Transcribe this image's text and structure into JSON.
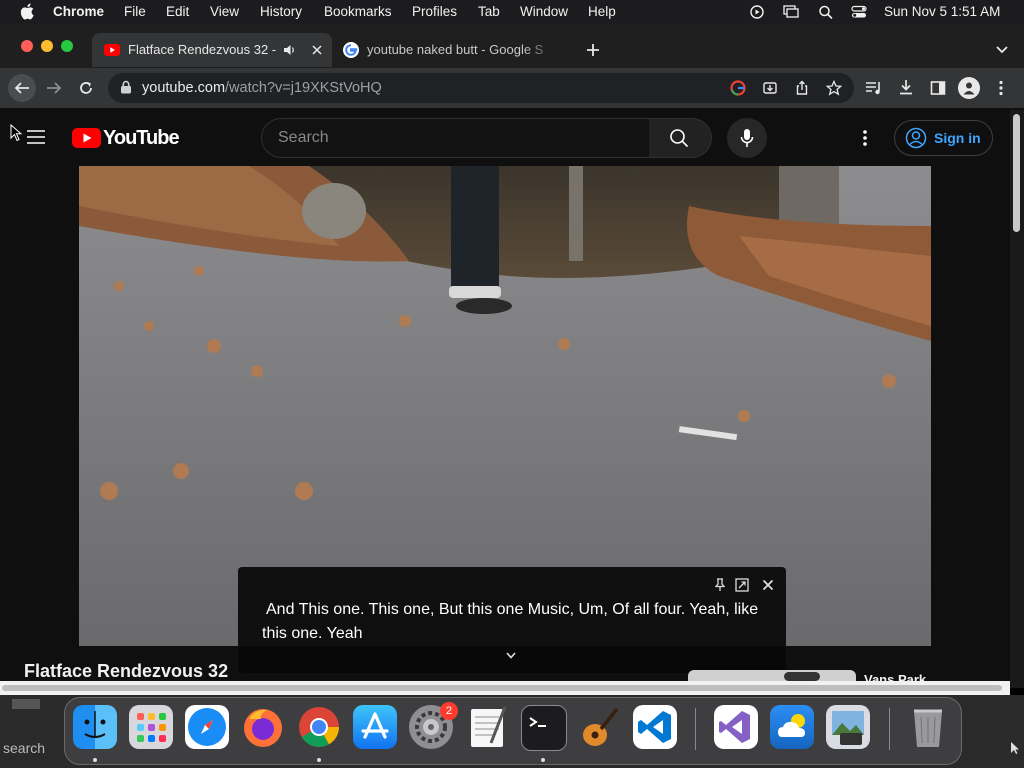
{
  "menubar": {
    "app": "Chrome",
    "items": [
      "File",
      "Edit",
      "View",
      "History",
      "Bookmarks",
      "Profiles",
      "Tab",
      "Window",
      "Help"
    ],
    "clock": "Sun Nov 5  1:51 AM"
  },
  "tabs": [
    {
      "title": "Flatface Rendezvous 32 -",
      "favicon": "youtube-icon",
      "audio": true
    },
    {
      "title": "youtube naked butt - Google S",
      "favicon": "google-icon"
    }
  ],
  "toolbar": {
    "url_host": "youtube.com",
    "url_path": "/watch?v=j19XKStVoHQ"
  },
  "youtube": {
    "logo_text": "YouTube",
    "search_placeholder": "Search",
    "sign_in": "Sign in",
    "video_title": "Flatface Rendezvous 32",
    "related_channel": "Vans Park"
  },
  "caption": {
    "text": "And This one. This one, But this one Music, Um, Of all four. Yeah, like this one. Yeah"
  },
  "dock": {
    "settings_badge": "2",
    "behind_text": "search"
  },
  "colors": {
    "youtube_red": "#ff0000",
    "signin_blue": "#3ea6ff",
    "badge_red": "#ff3b30"
  }
}
